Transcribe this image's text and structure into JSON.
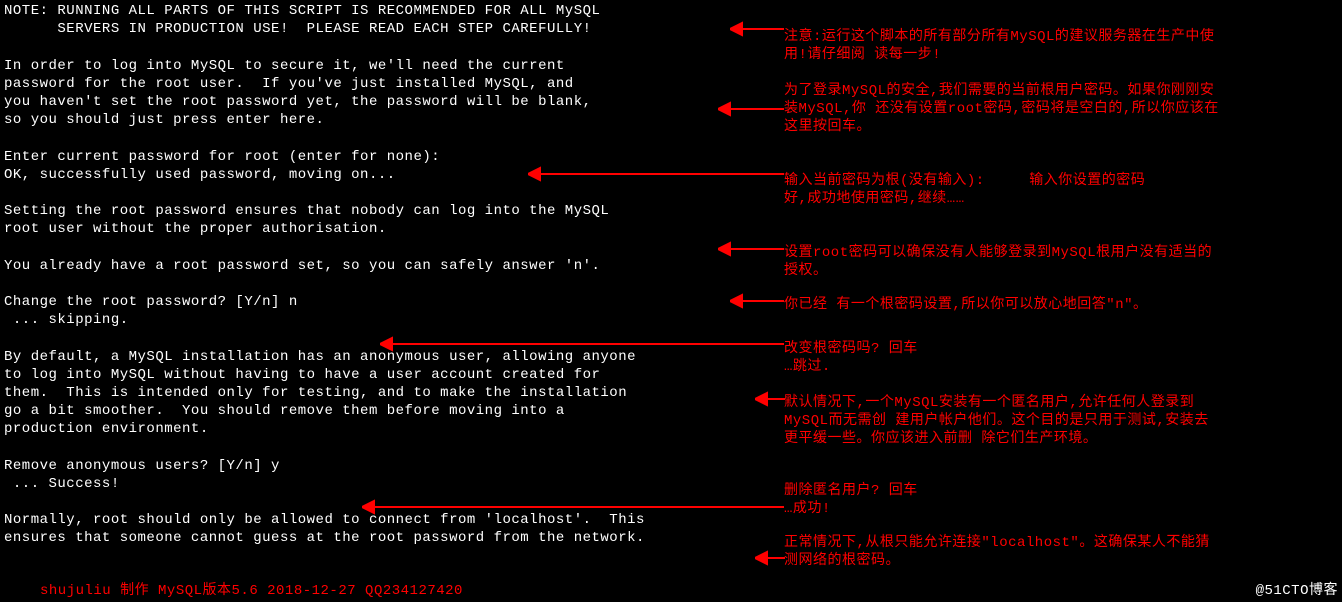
{
  "terminal_text": "NOTE: RUNNING ALL PARTS OF THIS SCRIPT IS RECOMMENDED FOR ALL MySQL\n      SERVERS IN PRODUCTION USE!  PLEASE READ EACH STEP CAREFULLY!\n\nIn order to log into MySQL to secure it, we'll need the current\npassword for the root user.  If you've just installed MySQL, and\nyou haven't set the root password yet, the password will be blank,\nso you should just press enter here.\n\nEnter current password for root (enter for none): \nOK, successfully used password, moving on...\n\nSetting the root password ensures that nobody can log into the MySQL\nroot user without the proper authorisation.\n\nYou already have a root password set, so you can safely answer 'n'.\n\nChange the root password? [Y/n] n\n ... skipping.\n\nBy default, a MySQL installation has an anonymous user, allowing anyone\nto log into MySQL without having to have a user account created for\nthem.  This is intended only for testing, and to make the installation\ngo a bit smoother.  You should remove them before moving into a\nproduction environment.\n\nRemove anonymous users? [Y/n] y\n ... Success!\n\nNormally, root should only be allowed to connect from 'localhost'.  This\nensures that someone cannot guess at the root password from the network.",
  "annotations": {
    "note1": "注意:运行这个脚本的所有部分所有MySQL的建议服务器在生产中使\n用!请仔细阅 读每一步!",
    "note2": "为了登录MySQL的安全,我们需要的当前根用户密码。如果你刚刚安\n装MySQL,你 还没有设置root密码,密码将是空白的,所以你应该在\n这里按回车。",
    "note3": "输入当前密码为根(没有输入):     输入你设置的密码\n好,成功地使用密码,继续……",
    "note4": "设置root密码可以确保没有人能够登录到MySQL根用户没有适当的\n授权。",
    "note5": "你已经 有一个根密码设置,所以你可以放心地回答\"n\"。",
    "note6": "改变根密码吗? 回车\n…跳过.",
    "note7": "默认情况下,一个MySQL安装有一个匿名用户,允许任何人登录到\nMySQL而无需创 建用户帐户他们。这个目的是只用于测试,安装去\n更平缓一些。你应该进入前删 除它们生产环境。",
    "note8": "删除匿名用户? 回车\n…成功!",
    "note9": "正常情况下,从根只能允许连接\"localhost\"。这确保某人不能猜\n测网络的根密码。"
  },
  "footer_left": "shujuliu 制作 MySQL版本5.6 2018-12-27 QQ234127420",
  "footer_right": "@51CTO博客"
}
